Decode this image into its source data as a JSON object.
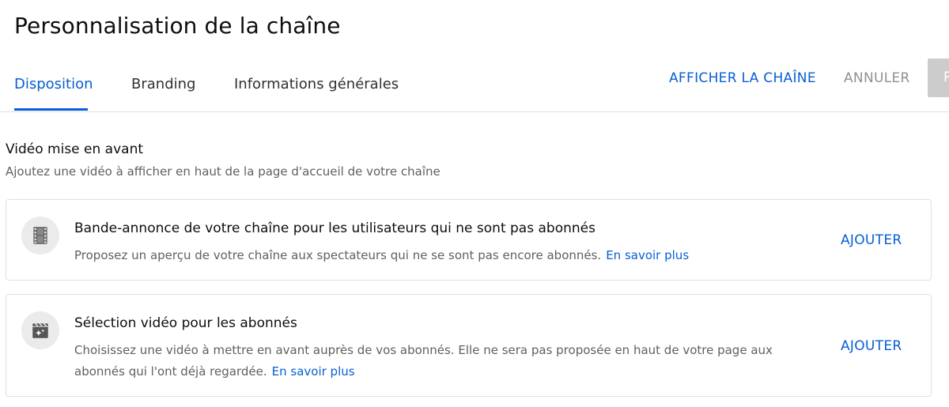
{
  "page_title": "Personnalisation de la chaîne",
  "tabs": [
    {
      "label": "Disposition",
      "active": true
    },
    {
      "label": "Branding",
      "active": false
    },
    {
      "label": "Informations générales",
      "active": false
    }
  ],
  "header_actions": {
    "view_channel": "AFFICHER LA CHAÎNE",
    "cancel": "ANNULER",
    "publish_partial": "P"
  },
  "section": {
    "title": "Vidéo mise en avant",
    "subtitle": "Ajoutez une vidéo à afficher en haut de la page d'accueil de votre chaîne"
  },
  "cards": [
    {
      "icon": "film-icon",
      "title": "Bande-annonce de votre chaîne pour les utilisateurs qui ne sont pas abonnés",
      "description": "Proposez un aperçu de votre chaîne aux spectateurs qui ne se sont pas encore abonnés.",
      "learn_more": "En savoir plus",
      "action": "AJOUTER"
    },
    {
      "icon": "featured-video-icon",
      "title": "Sélection vidéo pour les abonnés",
      "description": "Choisissez une vidéo à mettre en avant auprès de vos abonnés. Elle ne sera pas proposée en haut de votre page aux abonnés qui l'ont déjà regardée.",
      "learn_more": "En savoir plus",
      "action": "AJOUTER"
    }
  ],
  "colors": {
    "accent": "#065fd4",
    "text_primary": "#0d0d0d",
    "text_secondary": "#606060",
    "disabled": "#909090",
    "divider": "#e0e0e0"
  }
}
